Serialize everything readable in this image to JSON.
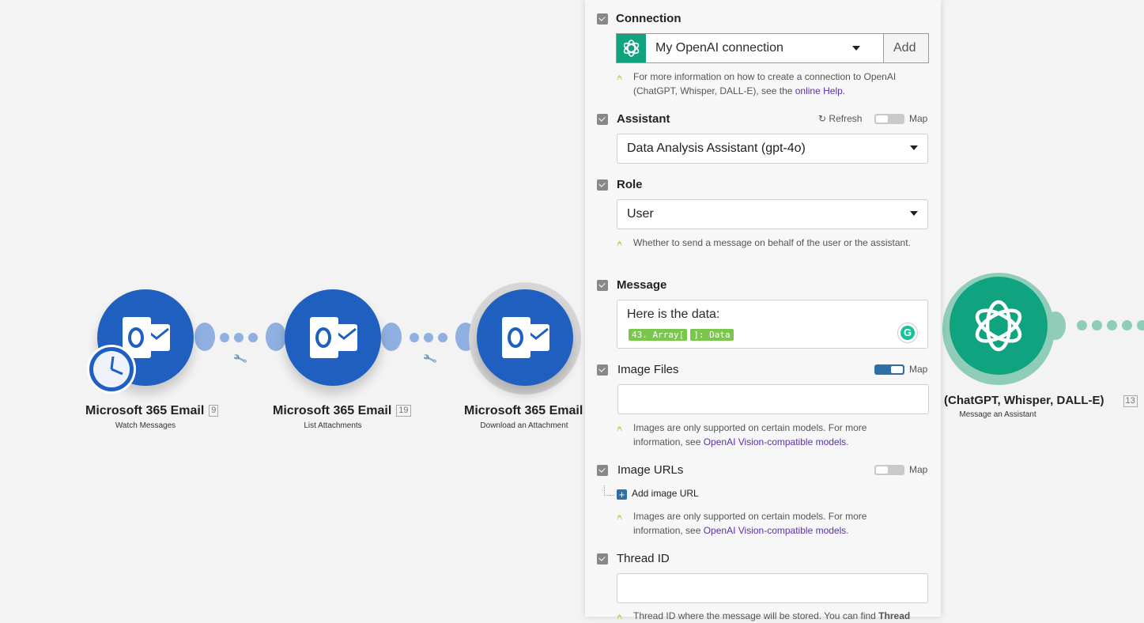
{
  "modules": [
    {
      "title": "Microsoft 365 Email",
      "count": "9",
      "subtitle": "Watch Messages"
    },
    {
      "title": "Microsoft 365 Email",
      "count": "19",
      "subtitle": "List Attachments"
    },
    {
      "title": "Microsoft 365 Email",
      "count": "",
      "subtitle": "Download an Attachment"
    },
    {
      "title": "(ChatGPT, Whisper, DALL-E)",
      "count": "13",
      "subtitle": "Message an Assistant"
    }
  ],
  "icons": {
    "outlook": "outlook-icon",
    "clock": "clock-icon",
    "openai": "openai-icon",
    "wrench": "wrench-icon"
  },
  "colors": {
    "outlook_blue": "#1e5fbf",
    "connector_blue": "#8fb0e0",
    "openai_green": "#10a37f",
    "connector_green": "#8fcdb8",
    "link_purple": "#5b2fb3",
    "toggle_on": "#2e6fa8"
  },
  "panel": {
    "connection": {
      "label": "Connection",
      "value": "My OpenAI connection",
      "add_label": "Add",
      "hint_text": "For more information on how to create a connection to OpenAI (ChatGPT, Whisper, DALL-E), see the ",
      "hint_link": "online Help",
      "hint_end": "."
    },
    "assistant": {
      "label": "Assistant",
      "refresh_label": "Refresh",
      "map_label": "Map",
      "map_on": false,
      "value": "Data Analysis Assistant (gpt-4o)"
    },
    "role": {
      "label": "Role",
      "value": "User",
      "hint": "Whether to send a message on behalf of the user or the assistant."
    },
    "message": {
      "label": "Message",
      "text": "Here is the data:",
      "pill_1": "43. Array[",
      "pill_2": "]: Data"
    },
    "image_files": {
      "label": "Image Files",
      "map_label": "Map",
      "map_on": true,
      "value": "",
      "hint_text": "Images are only supported on certain models. For more information, see ",
      "hint_link": "OpenAI Vision-compatible models",
      "hint_end": "."
    },
    "image_urls": {
      "label": "Image URLs",
      "map_label": "Map",
      "map_on": false,
      "add_label": "Add image URL",
      "hint_text": "Images are only supported on certain models. For more information, see ",
      "hint_link": "OpenAI Vision-compatible models",
      "hint_end": "."
    },
    "thread_id": {
      "label": "Thread ID",
      "value": "",
      "hint_text": "Thread ID where the message will be stored. You can find ",
      "hint_bold": "Thread"
    }
  }
}
